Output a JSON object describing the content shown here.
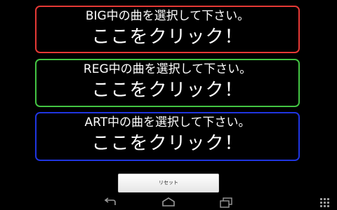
{
  "buttons": [
    {
      "title": "BIG中の曲を選択して下さい。",
      "action": "ここをクリック！",
      "color": "#e53935"
    },
    {
      "title": "REG中の曲を選択して下さい。",
      "action": "ここをクリック！",
      "color": "#43c443"
    },
    {
      "title": "ART中の曲を選択して下さい。",
      "action": "ここをクリック！",
      "color": "#1f35e0"
    }
  ],
  "reset": {
    "label": "リセット"
  },
  "navbar": {
    "icons": [
      "back-icon",
      "home-icon",
      "recent-apps-icon",
      "grid-menu-icon"
    ]
  }
}
